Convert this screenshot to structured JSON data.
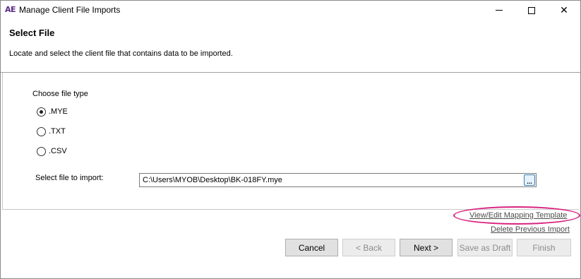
{
  "window": {
    "app_logo": "AE",
    "title": "Manage Client File Imports",
    "controls": {
      "minimize": "minimize",
      "maximize": "maximize",
      "close": "✕"
    }
  },
  "header": {
    "title": "Select File",
    "description": "Locate and select the client file that contains data to be imported."
  },
  "file_type": {
    "label": "Choose file type",
    "options": [
      {
        "label": ".MYE",
        "checked": true
      },
      {
        "label": ".TXT",
        "checked": false
      },
      {
        "label": ".CSV",
        "checked": false
      }
    ]
  },
  "file_select": {
    "label": "Select file to import:",
    "value": "C:\\Users\\MYOB\\Desktop\\BK-018FY.mye",
    "browse_label": "..."
  },
  "links": {
    "mapping": "View/Edit Mapping Template",
    "delete": "Delete Previous Import"
  },
  "buttons": {
    "cancel": "Cancel",
    "back": "< Back",
    "next": "Next >",
    "save_draft": "Save as Draft",
    "finish": "Finish"
  },
  "colors": {
    "highlight": "#d9237f",
    "logo": "#5b2a86"
  }
}
